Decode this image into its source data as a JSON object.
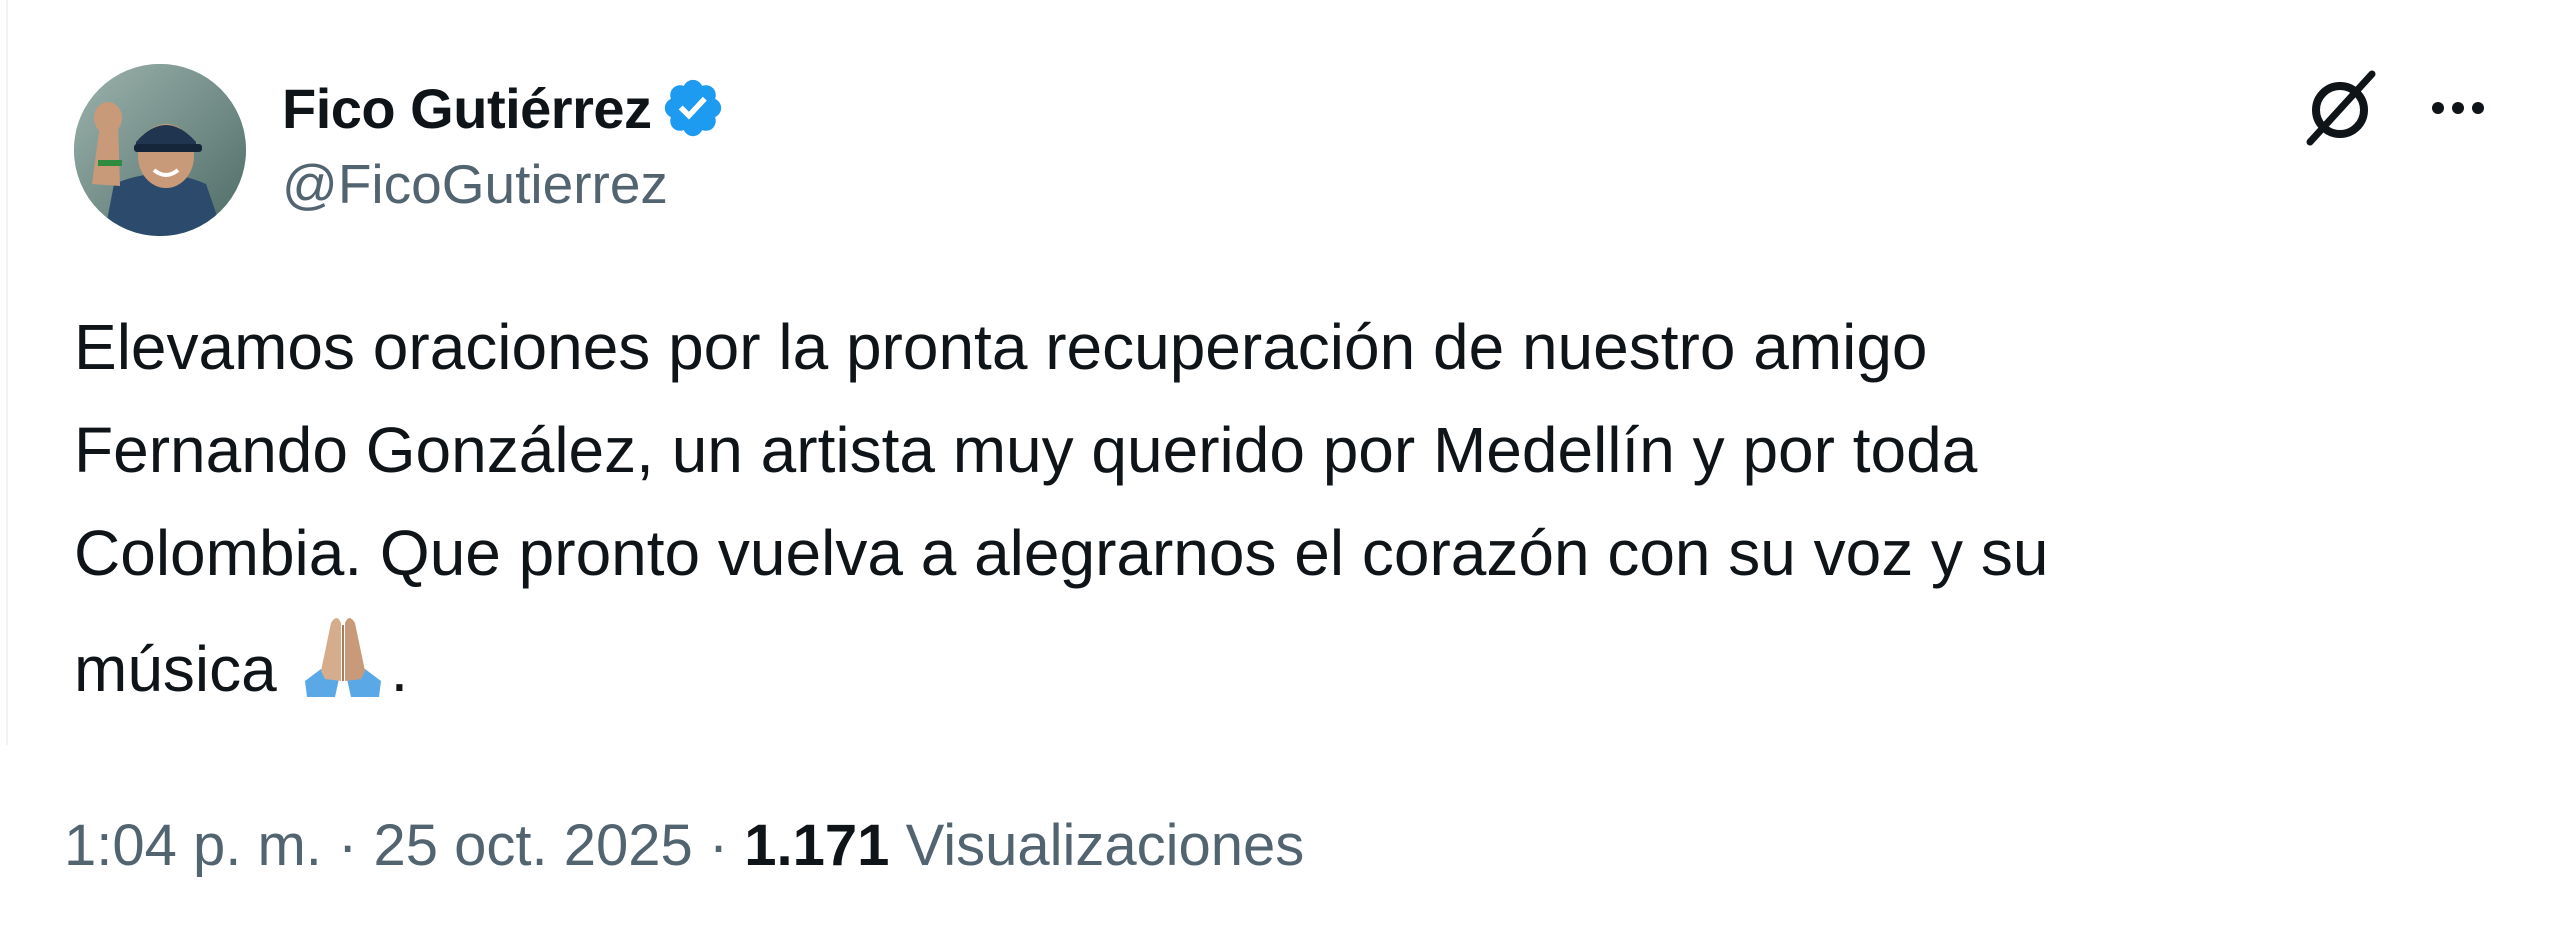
{
  "author": {
    "display_name": "Fico Gutiérrez",
    "handle": "@FicoGutierrez",
    "verified": true
  },
  "icons": {
    "verified": "verified-badge-icon",
    "grok": "grok-icon",
    "more": "more-options-icon",
    "emoji": "folded-hands-emoji"
  },
  "tweet": {
    "text_main": "Elevamos oraciones por la pronta recuperación de nuestro amigo\nFernando González, un artista muy querido por Medellín y por toda\nColombia. Que pronto vuelva a alegrarnos el corazón con su voz y su\nmúsica ",
    "text_end": "."
  },
  "meta": {
    "time": "1:04 p. m.",
    "separator": " · ",
    "date": "25 oct. 2025",
    "views_count": "1.171",
    "views_label": "Visualizaciones"
  },
  "colors": {
    "text": "#0f1419",
    "secondary": "#536471",
    "verified": "#1d9bf0"
  }
}
